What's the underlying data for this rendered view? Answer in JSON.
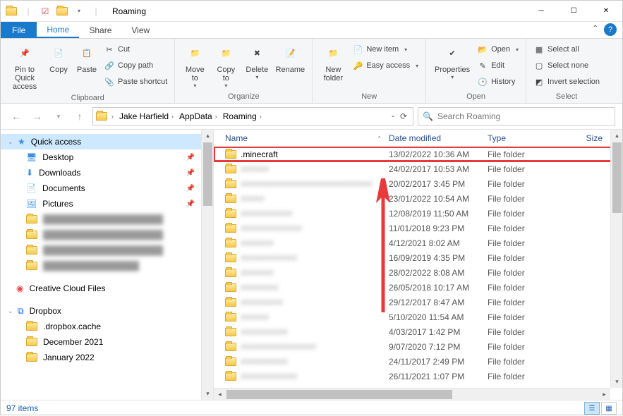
{
  "titlebar": {
    "title": "Roaming"
  },
  "tabs": {
    "file": "File",
    "home": "Home",
    "share": "Share",
    "view": "View"
  },
  "ribbon": {
    "clipboard": {
      "pin": "Pin to Quick\naccess",
      "copy": "Copy",
      "paste": "Paste",
      "cut": "Cut",
      "copypath": "Copy path",
      "pasteshortcut": "Paste shortcut",
      "label": "Clipboard"
    },
    "organize": {
      "moveto": "Move\nto",
      "copyto": "Copy\nto",
      "delete": "Delete",
      "rename": "Rename",
      "label": "Organize"
    },
    "new": {
      "newfolder": "New\nfolder",
      "newitem": "New item",
      "easyaccess": "Easy access",
      "label": "New"
    },
    "open": {
      "properties": "Properties",
      "open": "Open",
      "edit": "Edit",
      "history": "History",
      "label": "Open"
    },
    "select": {
      "selectall": "Select all",
      "selectnone": "Select none",
      "invert": "Invert selection",
      "label": "Select"
    }
  },
  "breadcrumb": [
    "Jake Harfield",
    "AppData",
    "Roaming"
  ],
  "search": {
    "placeholder": "Search Roaming"
  },
  "sidebar": {
    "quick": "Quick access",
    "items": [
      "Desktop",
      "Downloads",
      "Documents",
      "Pictures"
    ],
    "creative": "Creative Cloud Files",
    "dropbox": "Dropbox",
    "dropbox_items": [
      ".dropbox.cache",
      "December 2021",
      "January 2022"
    ]
  },
  "columns": {
    "name": "Name",
    "date": "Date modified",
    "type": "Type",
    "size": "Size"
  },
  "files": [
    {
      "name": ".minecraft",
      "date": "13/02/2022 10:36 AM",
      "type": "File folder",
      "highlight": true
    },
    {
      "name": "######",
      "date": "24/02/2017 10:53 AM",
      "type": "File folder",
      "blur": true
    },
    {
      "name": "############################",
      "date": "20/02/2017 3:45 PM",
      "type": "File folder",
      "blur": true
    },
    {
      "name": "#####",
      "date": "23/01/2022 10:54 AM",
      "type": "File folder",
      "blur": true
    },
    {
      "name": "###########",
      "date": "12/08/2019 11:50 AM",
      "type": "File folder",
      "blur": true
    },
    {
      "name": "#############",
      "date": "11/01/2018 9:23 PM",
      "type": "File folder",
      "blur": true
    },
    {
      "name": "#######",
      "date": "4/12/2021 8:02 AM",
      "type": "File folder",
      "blur": true
    },
    {
      "name": "############",
      "date": "16/09/2019 4:35 PM",
      "type": "File folder",
      "blur": true
    },
    {
      "name": "#######",
      "date": "28/02/2022 8:08 AM",
      "type": "File folder",
      "blur": true
    },
    {
      "name": "########",
      "date": "26/05/2018 10:17 AM",
      "type": "File folder",
      "blur": true
    },
    {
      "name": "#########",
      "date": "29/12/2017 8:47 AM",
      "type": "File folder",
      "blur": true
    },
    {
      "name": "######",
      "date": "5/10/2020 11:54 AM",
      "type": "File folder",
      "blur": true
    },
    {
      "name": "##########",
      "date": "4/03/2017 1:42 PM",
      "type": "File folder",
      "blur": true
    },
    {
      "name": "################",
      "date": "9/07/2020 7:12 PM",
      "type": "File folder",
      "blur": true
    },
    {
      "name": "##########",
      "date": "24/11/2017 2:49 PM",
      "type": "File folder",
      "blur": true
    },
    {
      "name": "############",
      "date": "26/11/2021 1:07 PM",
      "type": "File folder",
      "blur": true
    }
  ],
  "status": {
    "count": "97 items"
  }
}
